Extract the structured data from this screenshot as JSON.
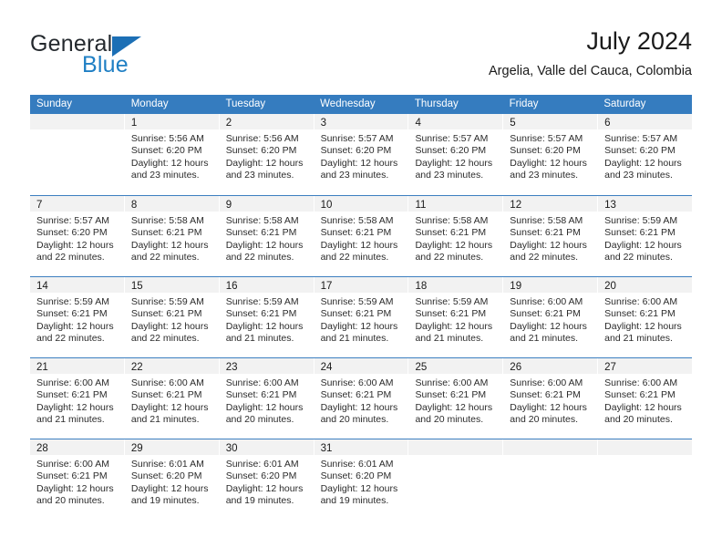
{
  "brand": {
    "name_part1": "General",
    "name_part2": "Blue",
    "triangle_color": "#1c6fb5",
    "blue_color": "#1f7fc4"
  },
  "header": {
    "title": "July 2024",
    "subtitle": "Argelia, Valle del Cauca, Colombia"
  },
  "theme": {
    "header_blue": "#357cbf",
    "week_rule": "#3c7fc0",
    "day_band": "#f2f2f2"
  },
  "weekdays": [
    "Sunday",
    "Monday",
    "Tuesday",
    "Wednesday",
    "Thursday",
    "Friday",
    "Saturday"
  ],
  "weeks": [
    [
      {
        "day": "",
        "lines": []
      },
      {
        "day": "1",
        "lines": [
          "Sunrise: 5:56 AM",
          "Sunset: 6:20 PM",
          "Daylight: 12 hours",
          "and 23 minutes."
        ]
      },
      {
        "day": "2",
        "lines": [
          "Sunrise: 5:56 AM",
          "Sunset: 6:20 PM",
          "Daylight: 12 hours",
          "and 23 minutes."
        ]
      },
      {
        "day": "3",
        "lines": [
          "Sunrise: 5:57 AM",
          "Sunset: 6:20 PM",
          "Daylight: 12 hours",
          "and 23 minutes."
        ]
      },
      {
        "day": "4",
        "lines": [
          "Sunrise: 5:57 AM",
          "Sunset: 6:20 PM",
          "Daylight: 12 hours",
          "and 23 minutes."
        ]
      },
      {
        "day": "5",
        "lines": [
          "Sunrise: 5:57 AM",
          "Sunset: 6:20 PM",
          "Daylight: 12 hours",
          "and 23 minutes."
        ]
      },
      {
        "day": "6",
        "lines": [
          "Sunrise: 5:57 AM",
          "Sunset: 6:20 PM",
          "Daylight: 12 hours",
          "and 23 minutes."
        ]
      }
    ],
    [
      {
        "day": "7",
        "lines": [
          "Sunrise: 5:57 AM",
          "Sunset: 6:20 PM",
          "Daylight: 12 hours",
          "and 22 minutes."
        ]
      },
      {
        "day": "8",
        "lines": [
          "Sunrise: 5:58 AM",
          "Sunset: 6:21 PM",
          "Daylight: 12 hours",
          "and 22 minutes."
        ]
      },
      {
        "day": "9",
        "lines": [
          "Sunrise: 5:58 AM",
          "Sunset: 6:21 PM",
          "Daylight: 12 hours",
          "and 22 minutes."
        ]
      },
      {
        "day": "10",
        "lines": [
          "Sunrise: 5:58 AM",
          "Sunset: 6:21 PM",
          "Daylight: 12 hours",
          "and 22 minutes."
        ]
      },
      {
        "day": "11",
        "lines": [
          "Sunrise: 5:58 AM",
          "Sunset: 6:21 PM",
          "Daylight: 12 hours",
          "and 22 minutes."
        ]
      },
      {
        "day": "12",
        "lines": [
          "Sunrise: 5:58 AM",
          "Sunset: 6:21 PM",
          "Daylight: 12 hours",
          "and 22 minutes."
        ]
      },
      {
        "day": "13",
        "lines": [
          "Sunrise: 5:59 AM",
          "Sunset: 6:21 PM",
          "Daylight: 12 hours",
          "and 22 minutes."
        ]
      }
    ],
    [
      {
        "day": "14",
        "lines": [
          "Sunrise: 5:59 AM",
          "Sunset: 6:21 PM",
          "Daylight: 12 hours",
          "and 22 minutes."
        ]
      },
      {
        "day": "15",
        "lines": [
          "Sunrise: 5:59 AM",
          "Sunset: 6:21 PM",
          "Daylight: 12 hours",
          "and 22 minutes."
        ]
      },
      {
        "day": "16",
        "lines": [
          "Sunrise: 5:59 AM",
          "Sunset: 6:21 PM",
          "Daylight: 12 hours",
          "and 21 minutes."
        ]
      },
      {
        "day": "17",
        "lines": [
          "Sunrise: 5:59 AM",
          "Sunset: 6:21 PM",
          "Daylight: 12 hours",
          "and 21 minutes."
        ]
      },
      {
        "day": "18",
        "lines": [
          "Sunrise: 5:59 AM",
          "Sunset: 6:21 PM",
          "Daylight: 12 hours",
          "and 21 minutes."
        ]
      },
      {
        "day": "19",
        "lines": [
          "Sunrise: 6:00 AM",
          "Sunset: 6:21 PM",
          "Daylight: 12 hours",
          "and 21 minutes."
        ]
      },
      {
        "day": "20",
        "lines": [
          "Sunrise: 6:00 AM",
          "Sunset: 6:21 PM",
          "Daylight: 12 hours",
          "and 21 minutes."
        ]
      }
    ],
    [
      {
        "day": "21",
        "lines": [
          "Sunrise: 6:00 AM",
          "Sunset: 6:21 PM",
          "Daylight: 12 hours",
          "and 21 minutes."
        ]
      },
      {
        "day": "22",
        "lines": [
          "Sunrise: 6:00 AM",
          "Sunset: 6:21 PM",
          "Daylight: 12 hours",
          "and 21 minutes."
        ]
      },
      {
        "day": "23",
        "lines": [
          "Sunrise: 6:00 AM",
          "Sunset: 6:21 PM",
          "Daylight: 12 hours",
          "and 20 minutes."
        ]
      },
      {
        "day": "24",
        "lines": [
          "Sunrise: 6:00 AM",
          "Sunset: 6:21 PM",
          "Daylight: 12 hours",
          "and 20 minutes."
        ]
      },
      {
        "day": "25",
        "lines": [
          "Sunrise: 6:00 AM",
          "Sunset: 6:21 PM",
          "Daylight: 12 hours",
          "and 20 minutes."
        ]
      },
      {
        "day": "26",
        "lines": [
          "Sunrise: 6:00 AM",
          "Sunset: 6:21 PM",
          "Daylight: 12 hours",
          "and 20 minutes."
        ]
      },
      {
        "day": "27",
        "lines": [
          "Sunrise: 6:00 AM",
          "Sunset: 6:21 PM",
          "Daylight: 12 hours",
          "and 20 minutes."
        ]
      }
    ],
    [
      {
        "day": "28",
        "lines": [
          "Sunrise: 6:00 AM",
          "Sunset: 6:21 PM",
          "Daylight: 12 hours",
          "and 20 minutes."
        ]
      },
      {
        "day": "29",
        "lines": [
          "Sunrise: 6:01 AM",
          "Sunset: 6:20 PM",
          "Daylight: 12 hours",
          "and 19 minutes."
        ]
      },
      {
        "day": "30",
        "lines": [
          "Sunrise: 6:01 AM",
          "Sunset: 6:20 PM",
          "Daylight: 12 hours",
          "and 19 minutes."
        ]
      },
      {
        "day": "31",
        "lines": [
          "Sunrise: 6:01 AM",
          "Sunset: 6:20 PM",
          "Daylight: 12 hours",
          "and 19 minutes."
        ]
      },
      {
        "day": "",
        "lines": []
      },
      {
        "day": "",
        "lines": []
      },
      {
        "day": "",
        "lines": []
      }
    ]
  ]
}
